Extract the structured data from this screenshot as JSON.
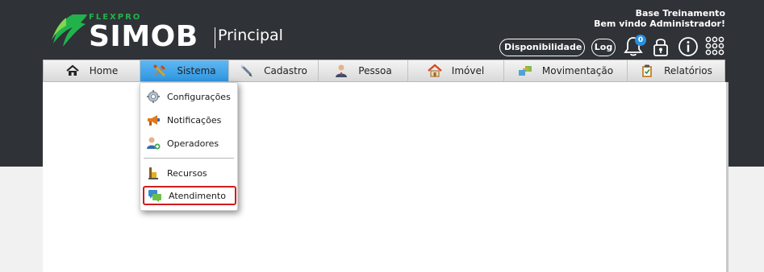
{
  "logo": {
    "brand_small": "FLEXPRO",
    "brand": "SIMOB",
    "module": "Principal"
  },
  "user": {
    "company": "Base Treinamento",
    "greeting": "Bem vindo Administrador!"
  },
  "toolbar": {
    "availability": "Disponibilidade",
    "log": "Log",
    "notification_count": "0"
  },
  "nav": {
    "items": [
      {
        "label": "Home",
        "icon": "home-icon"
      },
      {
        "label": "Sistema",
        "icon": "tools-icon",
        "active": true
      },
      {
        "label": "Cadastro",
        "icon": "pen-icon"
      },
      {
        "label": "Pessoa",
        "icon": "person-icon"
      },
      {
        "label": "Imóvel",
        "icon": "house-icon"
      },
      {
        "label": "Movimentação",
        "icon": "transfer-icon"
      },
      {
        "label": "Relatórios",
        "icon": "clipboard-icon"
      }
    ]
  },
  "menu": {
    "items": [
      {
        "label": "Configurações",
        "icon": "gear-icon"
      },
      {
        "label": "Notificações",
        "icon": "megaphone-icon"
      },
      {
        "label": "Operadores",
        "icon": "user-add-icon"
      },
      {
        "label": "Recursos",
        "icon": "resources-icon"
      },
      {
        "label": "Atendimento",
        "icon": "chat-icon",
        "highlighted": true
      }
    ]
  },
  "colors": {
    "header_bg": "#2f3237",
    "accent_green": "#22b24c",
    "active_tab": "#3fa3e8",
    "highlight_border": "#d01c1c"
  }
}
